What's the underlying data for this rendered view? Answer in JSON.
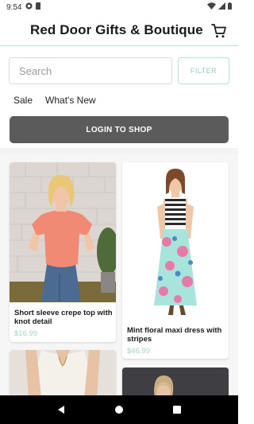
{
  "status_bar": {
    "time": "9:54",
    "left_icons": [
      "sync-icon",
      "sd-card-icon"
    ],
    "right_icons": [
      "wifi-icon",
      "signal-icon",
      "battery-icon"
    ]
  },
  "header": {
    "title": "Red Door Gifts & Boutique",
    "cart_icon": "cart-icon"
  },
  "search": {
    "placeholder": "Search",
    "value": "",
    "filter_label": "FILTER"
  },
  "categories": [
    "Sale",
    "What's New"
  ],
  "login_button": "LOGIN TO SHOP",
  "products": [
    {
      "name": "Short sleeve crepe top with knot detail",
      "price": "$16.99"
    },
    {
      "name": "Mint floral maxi dress with stripes",
      "price": "$46.99"
    },
    {
      "name": "",
      "price": ""
    },
    {
      "name": "",
      "price": ""
    }
  ],
  "colors": {
    "accent": "#9fd4c6",
    "login_bg": "#5b5b5b",
    "nav_bg": "#000000"
  },
  "nav": {
    "back_icon": "back-triangle-icon",
    "home_icon": "home-circle-icon",
    "recents_icon": "recents-square-icon"
  }
}
